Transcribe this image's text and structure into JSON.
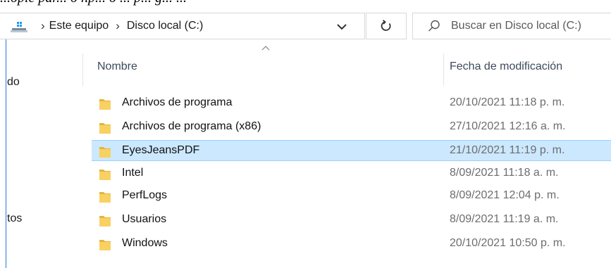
{
  "caption": "...opie par... o hp... o ... p... g... ...",
  "address": {
    "crumbs": [
      "Este equipo",
      "Disco local (C:)"
    ],
    "separator": "›"
  },
  "search": {
    "placeholder": "Buscar en Disco local (C:)"
  },
  "nav_fragments": [
    "do",
    "tos"
  ],
  "columns": {
    "name": "Nombre",
    "date": "Fecha de modificación"
  },
  "files": [
    {
      "name": "Archivos de programa",
      "date": "20/10/2021 11:18 p. m."
    },
    {
      "name": "Archivos de programa (x86)",
      "date": "27/10/2021 12:16 a. m."
    },
    {
      "name": "EyesJeansPDF",
      "date": "21/10/2021 11:19 p. m.",
      "selected": true
    },
    {
      "name": "Intel",
      "date": "8/09/2021 11:18 a. m."
    },
    {
      "name": "PerfLogs",
      "date": "8/09/2021 12:04 p. m."
    },
    {
      "name": "Usuarios",
      "date": "8/09/2021 11:19 a. m."
    },
    {
      "name": "Windows",
      "date": "20/10/2021 10:50 p. m."
    }
  ],
  "colors": {
    "selection": "#cce8ff",
    "selection_border": "#99d1ff",
    "folder": "#f5c542",
    "nav_edge": "#2a78d6"
  },
  "icons": [
    "this-pc-icon",
    "chevron-down-icon",
    "refresh-icon",
    "search-icon",
    "folder-icon",
    "sort-up-icon"
  ]
}
